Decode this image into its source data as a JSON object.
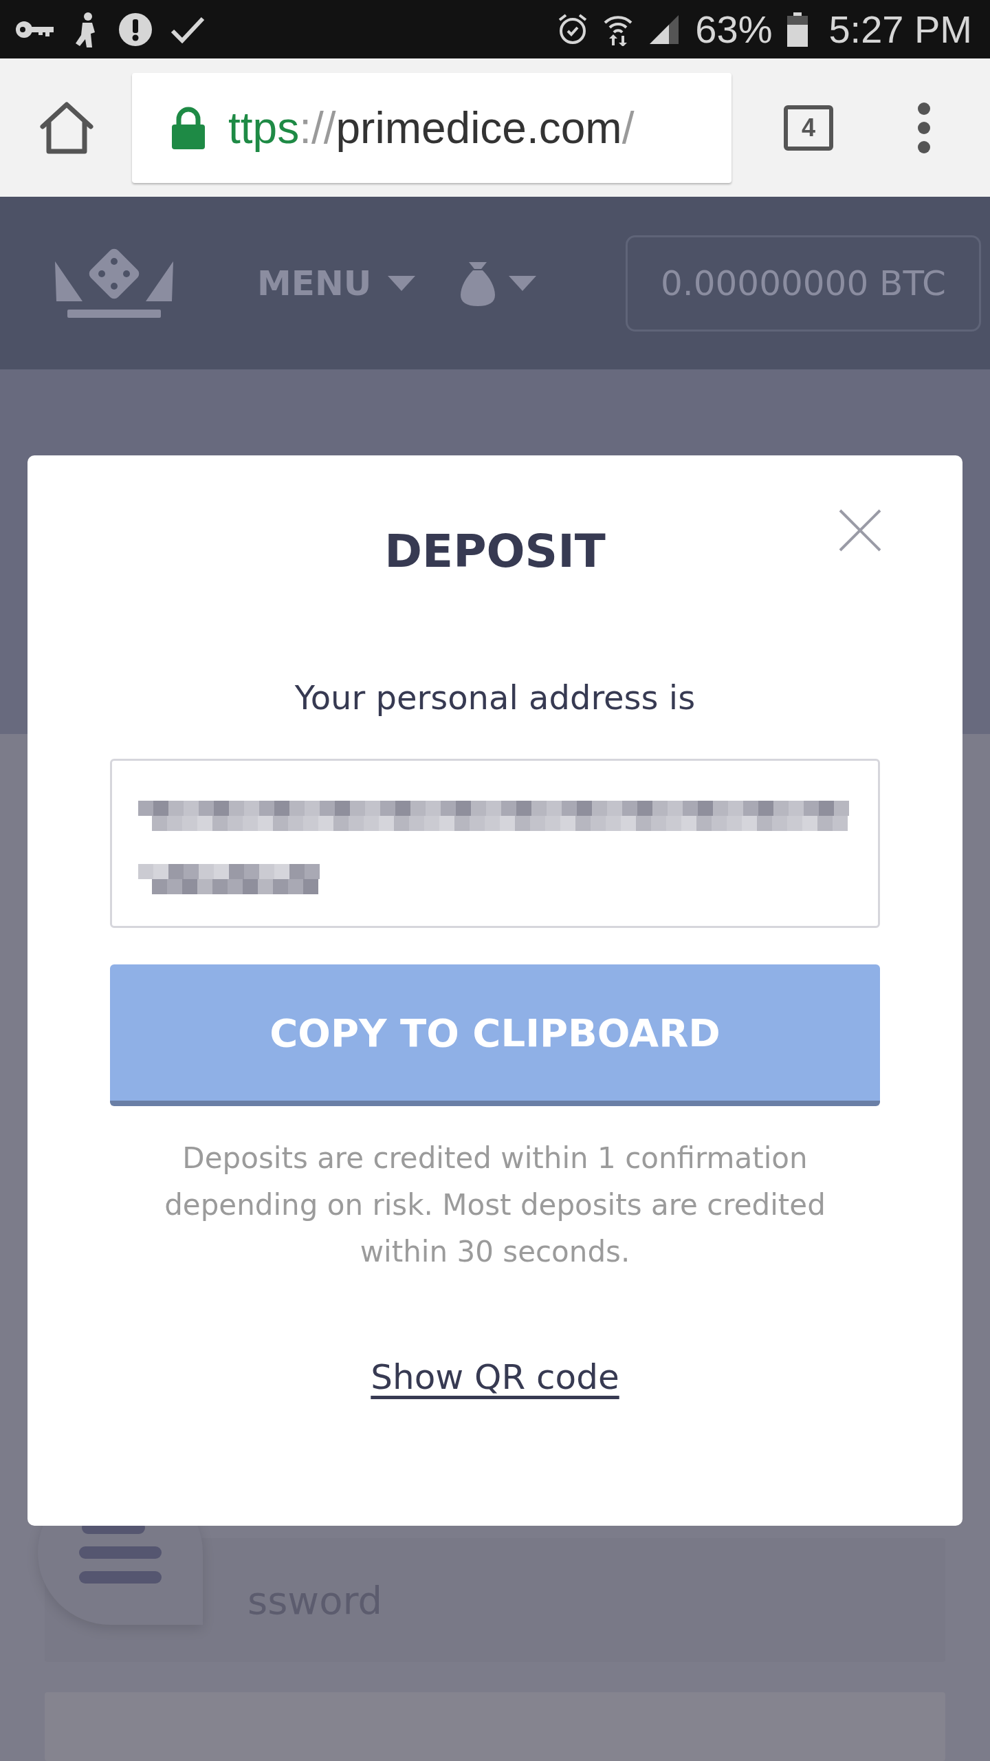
{
  "status_bar": {
    "battery": "63%",
    "time": "5:27 PM"
  },
  "browser": {
    "url_scheme": "ttps",
    "url_separator": "://",
    "url_host": "primedice.com",
    "url_rest": "/",
    "tab_count": "4"
  },
  "header": {
    "menu": "MENU",
    "balance": "0.00000000 BTC"
  },
  "modal": {
    "title": "DEPOSIT",
    "intro": "Your personal address is",
    "button": "COPY TO CLIPBOARD",
    "note": "Deposits are credited within 1 confirmation depending on risk. Most deposits are credited within 30 seconds.",
    "link": "Show QR code"
  },
  "background_form": {
    "password_placeholder": "ssword"
  }
}
